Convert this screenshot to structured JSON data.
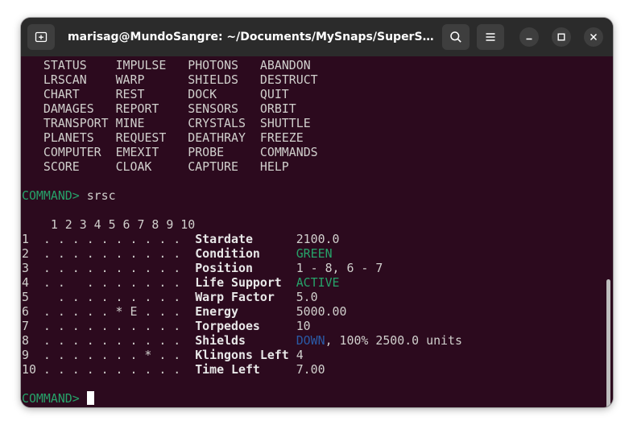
{
  "window": {
    "title": "marisag@MundoSangre: ~/Documents/MySnaps/SuperStarT..."
  },
  "icons": {
    "new_tab": "new-tab-icon",
    "search": "search-icon",
    "menu": "hamburger-menu-icon",
    "minimize": "minimize-icon",
    "maximize": "maximize-icon",
    "close": "close-icon"
  },
  "colors": {
    "terminal_bg": "#2c0a1e",
    "titlebar_bg": "#2b2b2b",
    "text": "#d0cfcc",
    "green": "#26a269",
    "blue": "#2a5aa6"
  },
  "terminal": {
    "commands": [
      [
        "STATUS",
        "IMPULSE",
        "PHOTONS",
        "ABANDON"
      ],
      [
        "LRSCAN",
        "WARP",
        "SHIELDS",
        "DESTRUCT"
      ],
      [
        "CHART",
        "REST",
        "DOCK",
        "QUIT"
      ],
      [
        "DAMAGES",
        "REPORT",
        "SENSORS",
        "ORBIT"
      ],
      [
        "TRANSPORT",
        "MINE",
        "CRYSTALS",
        "SHUTTLE"
      ],
      [
        "PLANETS",
        "REQUEST",
        "DEATHRAY",
        "FREEZE"
      ],
      [
        "COMPUTER",
        "EMEXIT",
        "PROBE",
        "COMMANDS"
      ],
      [
        "SCORE",
        "CLOAK",
        "CAPTURE",
        "HELP"
      ]
    ],
    "prompt": "COMMAND>",
    "entered_command": "srsc",
    "column_header": "1 2 3 4 5 6 7 8 9 10",
    "grid_rows": [
      {
        "num": "1",
        "cells": ". . . . . . . . . .",
        "label": "Stardate",
        "value": "2100.0",
        "value_style": ""
      },
      {
        "num": "2",
        "cells": ". . . . . . . . . .",
        "label": "Condition",
        "value": "GREEN",
        "value_style": "green"
      },
      {
        "num": "3",
        "cells": ". . . . . . . . . .",
        "label": "Position",
        "value": "1 - 8, 6 - 7",
        "value_style": ""
      },
      {
        "num": "4",
        "cells": ". .   . . . . . . .",
        "label": "Life Support",
        "value": "ACTIVE",
        "value_style": "green"
      },
      {
        "num": "5",
        "cells": "  . . . . . . . . .",
        "label": "Warp Factor",
        "value": "5.0",
        "value_style": ""
      },
      {
        "num": "6",
        "cells": ". . . . . * E . . .",
        "label": "Energy",
        "value": "5000.00",
        "value_style": ""
      },
      {
        "num": "7",
        "cells": ". . . . . . . . . .",
        "label": "Torpedoes",
        "value": "10",
        "value_style": ""
      },
      {
        "num": "8",
        "cells": ". . . . . . . . . .",
        "label": "Shields",
        "value": "DOWN",
        "value_style": "blue",
        "suffix": ", 100% 2500.0 units"
      },
      {
        "num": "9",
        "cells": ". . . . . . . * . .",
        "label": "Klingons Left",
        "value": "4",
        "value_style": ""
      },
      {
        "num": "10",
        "cells": ". . . . . . . . . .",
        "label": "Time Left",
        "value": "7.00",
        "value_style": ""
      }
    ],
    "final_prompt": "COMMAND>"
  }
}
